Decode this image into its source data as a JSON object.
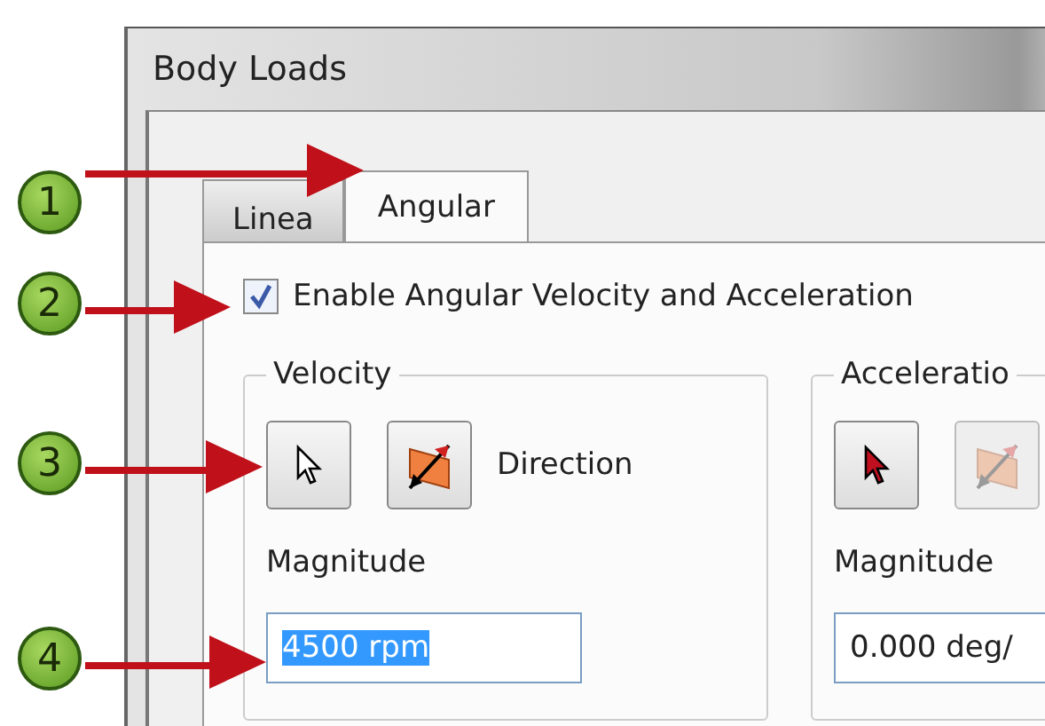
{
  "dialog": {
    "title": "Body Loads",
    "tabs": [
      {
        "label": "Linea",
        "selected": false
      },
      {
        "label": "Angular",
        "selected": true
      }
    ],
    "enable_checkbox": {
      "label": "Enable Angular Velocity and Acceleration",
      "checked": true
    },
    "groups": [
      {
        "title": "Velocity",
        "buttons": [
          {
            "kind": "select",
            "disabled": false
          },
          {
            "kind": "direction",
            "disabled": false
          }
        ],
        "direction_label": "Direction",
        "magnitude_label": "Magnitude",
        "magnitude_value": "4500 rpm",
        "value_selected": true
      },
      {
        "title": "Acceleratio",
        "buttons": [
          {
            "kind": "select",
            "disabled": false
          },
          {
            "kind": "direction",
            "disabled": true
          }
        ],
        "magnitude_label": "Magnitude",
        "magnitude_value": "0.000 deg/",
        "value_selected": false
      }
    ]
  },
  "callouts": [
    {
      "number": "1"
    },
    {
      "number": "2"
    },
    {
      "number": "3"
    },
    {
      "number": "4"
    }
  ]
}
